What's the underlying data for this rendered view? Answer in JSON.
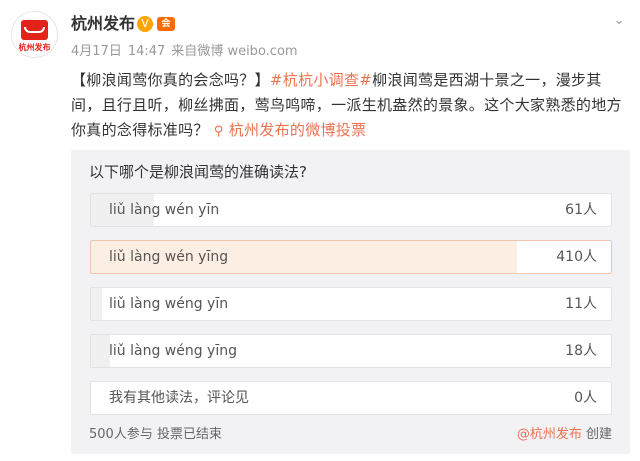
{
  "user": {
    "name": "杭州发布",
    "avatar_text": "杭州发布",
    "verified_symbol": "V",
    "vip_badge": "会"
  },
  "meta": {
    "date": "4月17日",
    "time": "14:47",
    "source_prefix": "来自",
    "source": "微博 weibo.com"
  },
  "post": {
    "title": "【柳浪闻莺你真的会念吗？】",
    "hashtag": "#杭杭小调查#",
    "body": "柳浪闻莺是西湖十景之一，漫步其间，且行且听，柳丝拂面，莺鸟鸣啼，一派生机盎然的景象。这个大家熟悉的地方你真的念得标准吗？",
    "link_icon": "⚲",
    "link_text": "杭州发布的微博投票"
  },
  "poll": {
    "question": "以下哪个是柳浪闻莺的准确读法?",
    "options": [
      {
        "label": "liǔ làng wén yīn",
        "count": "61人",
        "votes": 61
      },
      {
        "label": "liǔ làng wén yīng",
        "count": "410人",
        "votes": 410,
        "selected": true
      },
      {
        "label": "liǔ làng wéng yīn",
        "count": "11人",
        "votes": 11
      },
      {
        "label": "liǔ làng wéng yīng",
        "count": "18人",
        "votes": 18
      },
      {
        "label": "我有其他读法，评论见",
        "count": "0人",
        "votes": 0
      }
    ],
    "participants": "500人参与",
    "status": "投票已结束",
    "creator": "@杭州发布",
    "created_label": "创建"
  },
  "colors": {
    "accent": "#eb7350",
    "selected_fill": "#fdeee4",
    "poll_bg": "#f2f2f5"
  }
}
